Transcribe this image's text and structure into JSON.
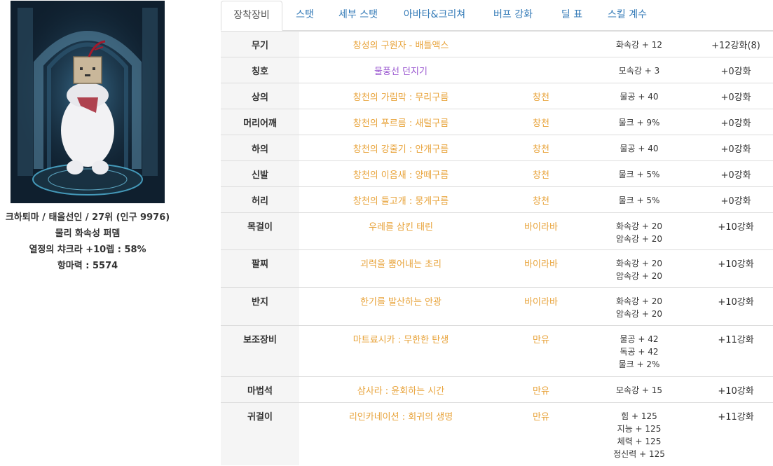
{
  "character": {
    "line1": "크하퇴마 / 태을선인 / 27위 (인구 9976)",
    "line2": "물리 화속성 퍼뎀",
    "line3": "열정의 챠크라 +10렙 : 58%",
    "line4": "항마력 : 5574"
  },
  "tabs": [
    "장착장비",
    "스탯",
    "세부 스탯",
    "아바타&크리쳐",
    "버프 강화",
    "딜 표",
    "스킬 계수"
  ],
  "active_tab": "장착장비",
  "equipment": [
    {
      "slot": "무기",
      "name": "창성의 구원자 - 배틀액스",
      "set": "",
      "options": [
        "화속강 + 12"
      ],
      "enhance": "+12강화(8)",
      "name_color": "orange"
    },
    {
      "slot": "칭호",
      "name": "물풍선 던지기",
      "set": "",
      "options": [
        "모속강 + 3"
      ],
      "enhance": "+0강화",
      "name_color": "purple"
    },
    {
      "slot": "상의",
      "name": "창천의 가림막 : 무리구름",
      "set": "창천",
      "options": [
        "물공 + 40"
      ],
      "enhance": "+0강화",
      "name_color": "orange"
    },
    {
      "slot": "머리어깨",
      "name": "창천의 푸르름 : 새털구름",
      "set": "창천",
      "options": [
        "물크 + 9%"
      ],
      "enhance": "+0강화",
      "name_color": "orange"
    },
    {
      "slot": "하의",
      "name": "창천의 강줄기 : 안개구름",
      "set": "창천",
      "options": [
        "물공 + 40"
      ],
      "enhance": "+0강화",
      "name_color": "orange"
    },
    {
      "slot": "신발",
      "name": "창천의 이음새 : 양떼구름",
      "set": "창천",
      "options": [
        "물크 + 5%"
      ],
      "enhance": "+0강화",
      "name_color": "orange"
    },
    {
      "slot": "허리",
      "name": "창천의 들고개 : 뭉게구름",
      "set": "창천",
      "options": [
        "물크 + 5%"
      ],
      "enhance": "+0강화",
      "name_color": "orange"
    },
    {
      "slot": "목걸이",
      "name": "우레를 삼킨 태린",
      "set": "바이라바",
      "options": [
        "화속강 + 20",
        "암속강 + 20"
      ],
      "enhance": "+10강화",
      "name_color": "orange"
    },
    {
      "slot": "팔찌",
      "name": "괴력을 뿜어내는 초리",
      "set": "바이라바",
      "options": [
        "화속강 + 20",
        "암속강 + 20"
      ],
      "enhance": "+10강화",
      "name_color": "orange"
    },
    {
      "slot": "반지",
      "name": "한기를 발산하는 안광",
      "set": "바이라바",
      "options": [
        "화속강 + 20",
        "암속강 + 20"
      ],
      "enhance": "+10강화",
      "name_color": "orange"
    },
    {
      "slot": "보조장비",
      "name": "마트료시카 : 무한한 탄생",
      "set": "만유",
      "options": [
        "물공 + 42",
        "독공 + 42",
        "물크 + 2%"
      ],
      "enhance": "+11강화",
      "name_color": "orange"
    },
    {
      "slot": "마법석",
      "name": "삼사라 : 윤회하는 시간",
      "set": "만유",
      "options": [
        "모속강 + 15"
      ],
      "enhance": "+10강화",
      "name_color": "orange"
    },
    {
      "slot": "귀걸이",
      "name": "리인카네이션 : 회귀의 생명",
      "set": "만유",
      "options": [
        "힘 + 125",
        "지능 + 125",
        "체력 + 125",
        "정신력 + 125"
      ],
      "enhance": "+11강화",
      "name_color": "orange"
    }
  ],
  "colors": {
    "item_orange": "#e8a33a",
    "title_purple": "#9b59d0",
    "tab_link": "#337ab7",
    "header_bg": "#f5f5f5"
  }
}
